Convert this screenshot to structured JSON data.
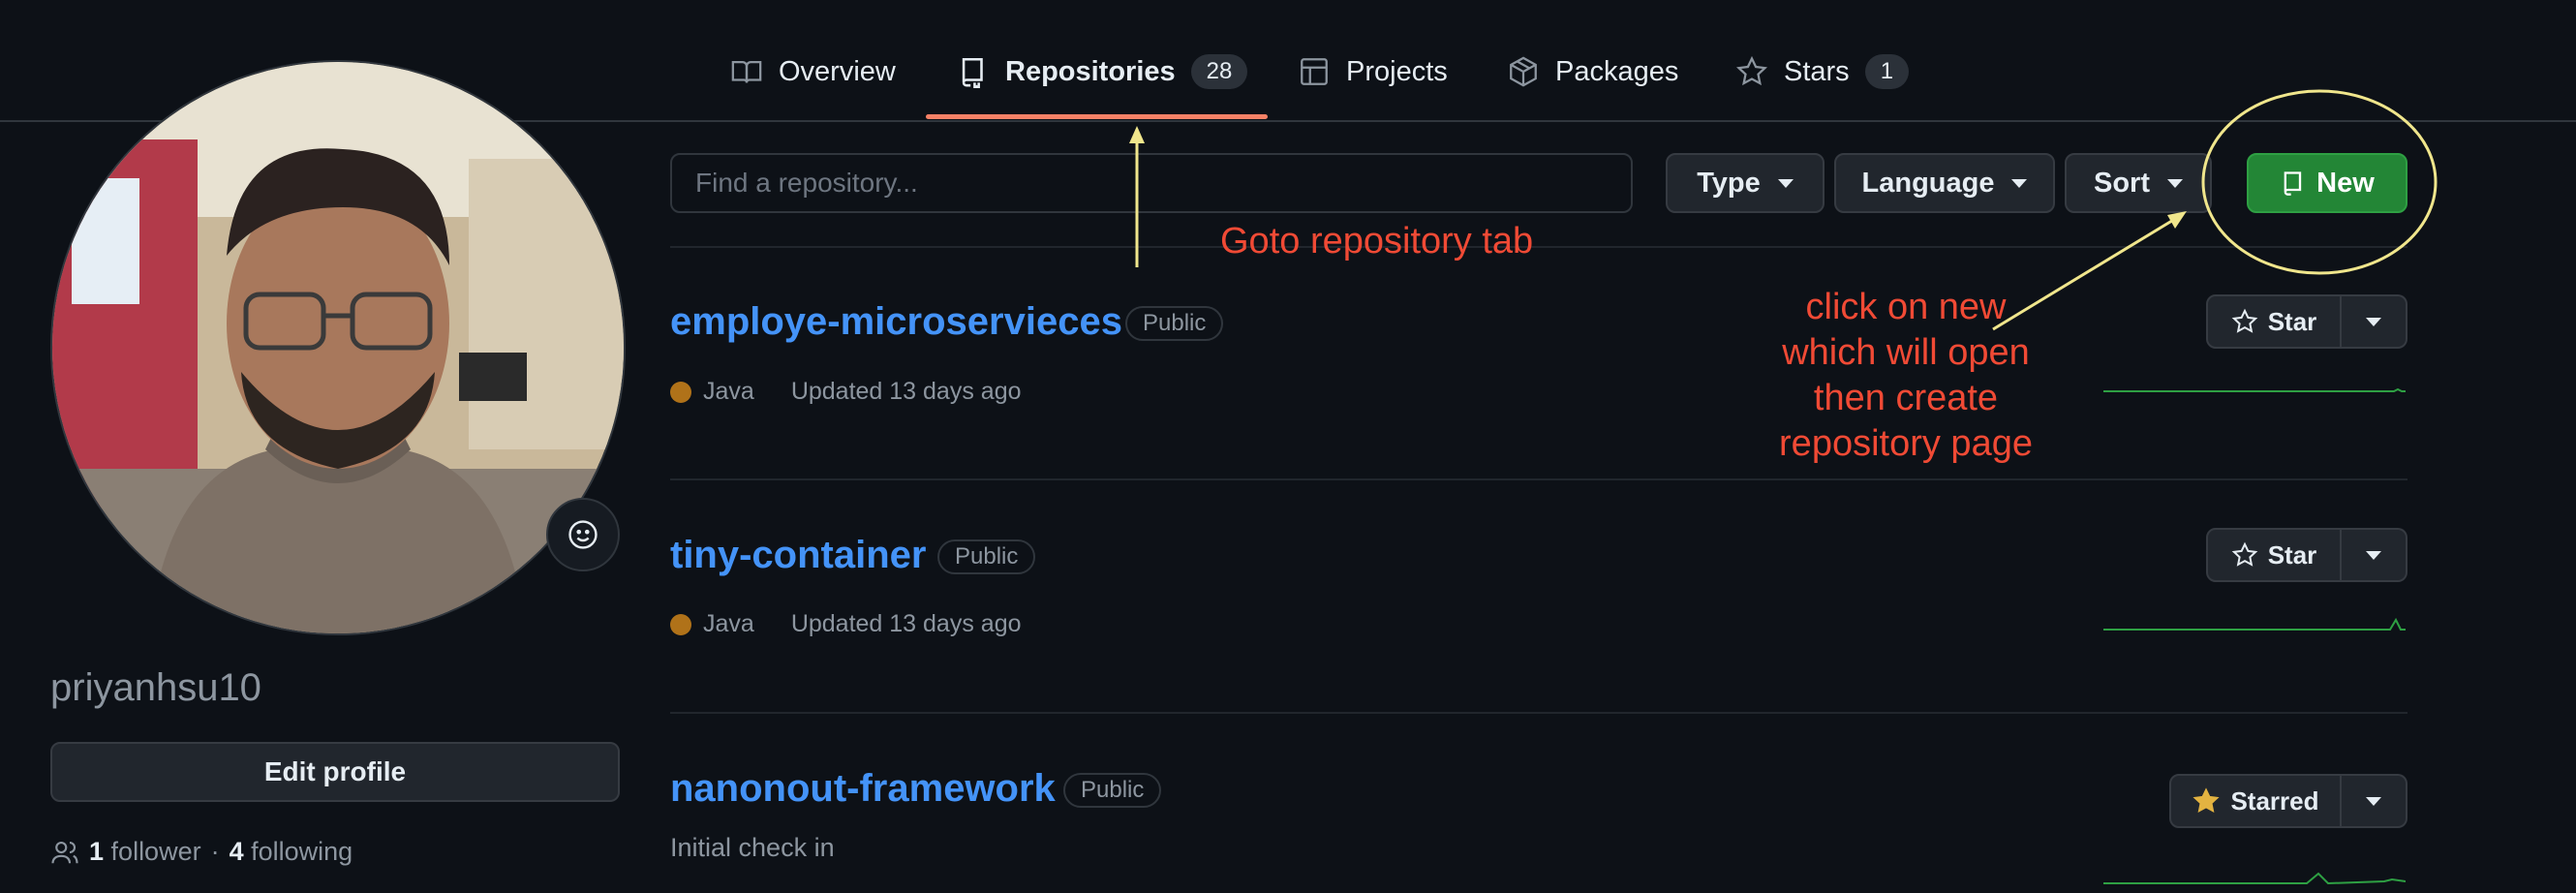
{
  "nav": {
    "tabs": [
      {
        "label": "Overview",
        "icon": "book-icon"
      },
      {
        "label": "Repositories",
        "count": "28",
        "icon": "repo-icon",
        "active": true
      },
      {
        "label": "Projects",
        "icon": "table-icon"
      },
      {
        "label": "Packages",
        "icon": "package-icon"
      },
      {
        "label": "Stars",
        "count": "1",
        "icon": "star-icon"
      }
    ],
    "active_color": "#f78166"
  },
  "profile": {
    "username": "priyanhsu10",
    "edit_label": "Edit profile",
    "followers_count": "1",
    "followers_label": "follower",
    "separator": "·",
    "following_count": "4",
    "following_label": "following"
  },
  "filters": {
    "search_placeholder": "Find a repository...",
    "type_label": "Type",
    "language_label": "Language",
    "sort_label": "Sort",
    "new_label": "New",
    "new_color": "#238636"
  },
  "repos": [
    {
      "name": "employe-microservieces",
      "visibility": "Public",
      "language": "Java",
      "updated": "Updated 13 days ago",
      "star_label": "Star"
    },
    {
      "name": "tiny-container",
      "visibility": "Public",
      "language": "Java",
      "updated": "Updated 13 days ago",
      "star_label": "Star"
    },
    {
      "name": "nanonout-framework",
      "visibility": "Public",
      "description": "Initial check in",
      "star_label": "Starred"
    }
  ],
  "annotations": {
    "goto_tab": "Goto  repository tab",
    "click_new": [
      "click on new",
      "which will  open",
      "then create",
      "repository  page"
    ],
    "color": "#f04a35",
    "highlight_color": "#f0e68c"
  }
}
